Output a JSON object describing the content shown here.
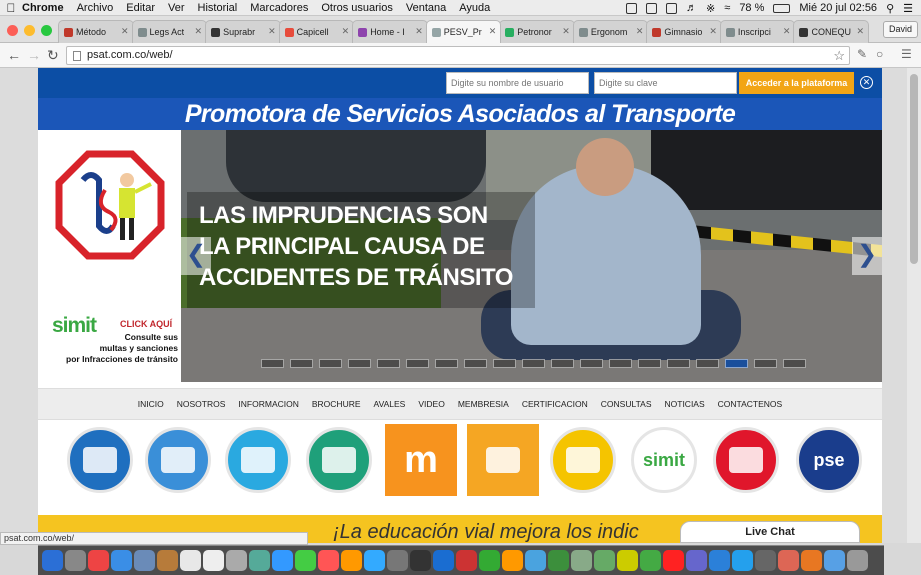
{
  "menubar": {
    "app": "Chrome",
    "items": [
      "Archivo",
      "Editar",
      "Ver",
      "Historial",
      "Marcadores",
      "Otros usuarios",
      "Ventana",
      "Ayuda"
    ],
    "battery": "78 %",
    "datetime": "Mié 20 jul  02:56"
  },
  "tabs": [
    {
      "label": "Método",
      "color": "#c0392b"
    },
    {
      "label": "Legs Act",
      "color": "#7f8c8d"
    },
    {
      "label": "Suprabr",
      "color": "#333333"
    },
    {
      "label": "Capicell",
      "color": "#e74c3c"
    },
    {
      "label": "Home - I",
      "color": "#8e44ad"
    },
    {
      "label": "PESV_Pr",
      "color": "#95a5a6"
    },
    {
      "label": "Petronor",
      "color": "#27ae60"
    },
    {
      "label": "Ergonom",
      "color": "#7f8c8d"
    },
    {
      "label": "Gimnasio",
      "color": "#c0392b"
    },
    {
      "label": "Inscripci",
      "color": "#7f8c8d"
    },
    {
      "label": "CONEQU",
      "color": "#333333"
    }
  ],
  "active_tab_index": 5,
  "user_button": "David",
  "address": "psat.com.co/web/",
  "login": {
    "user_placeholder": "Digite su nombre de usuario",
    "pass_placeholder": "Digite su clave",
    "submit": "Acceder a la plataforma"
  },
  "site_title": "Promotora de Servicios Asociados al Transporte",
  "simit": {
    "brand": "simit",
    "click": "CLICK AQUÍ",
    "line1": "Consulte sus",
    "line2": "multas y sanciones",
    "line3": "por Infracciones de tránsito"
  },
  "slide": {
    "lines": [
      "LAS IMPRUDENCIAS SON",
      "LA PRINCIPAL CAUSA DE",
      "ACCIDENTES DE TRÁNSITO"
    ],
    "prev": "❮",
    "next": "❯",
    "total_dots": 19,
    "active_dot": 16
  },
  "nav_menu": [
    "INICIO",
    "NOSOTROS",
    "INFORMACION",
    "BROCHURE",
    "AVALES",
    "VIDEO",
    "MEMBRESIA",
    "CERTIFICACION",
    "CONSULTAS",
    "NOTICIAS",
    "CONTACTENOS"
  ],
  "service_icons": [
    {
      "name": "group-icon",
      "bg": "#1f6fbf"
    },
    {
      "name": "binders-icon",
      "bg": "#3a8fd8"
    },
    {
      "name": "payment-icon",
      "bg": "#2aa9e0"
    },
    {
      "name": "people-icon",
      "bg": "#1fa07a"
    },
    {
      "name": "moodle-icon",
      "bg": "#f7931e",
      "text": "m"
    },
    {
      "name": "presentation-icon",
      "bg": "#f5a623"
    },
    {
      "name": "m-logo-icon",
      "bg": "#f5c400"
    },
    {
      "name": "simit-logo-icon",
      "bg": "#ffffff",
      "text": "simit"
    },
    {
      "name": "red-logo-icon",
      "bg": "#e0162b"
    },
    {
      "name": "pse-icon",
      "bg": "#1a3d8c",
      "text": "pse"
    }
  ],
  "bottom_banner": "¡La educación vial mejora los indic",
  "live_chat": "Live Chat",
  "status_url": "psat.com.co/web/"
}
